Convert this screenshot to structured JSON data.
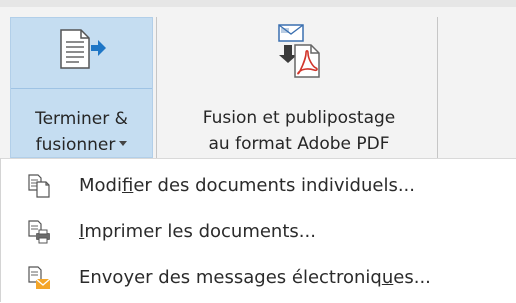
{
  "ribbon": {
    "finish_merge": {
      "line1": "Terminer &",
      "line2": "fusionner",
      "icon": "finish-merge-icon"
    },
    "pdf_merge": {
      "line1": "Fusion et publipostage",
      "line2": "au format Adobe PDF",
      "icon": "adobe-pdf-merge-icon"
    }
  },
  "menu": {
    "items": [
      {
        "pre": "Modi",
        "u": "f",
        "post": "ier des documents individuels...",
        "icon": "edit-documents-icon"
      },
      {
        "pre": "",
        "u": "I",
        "post": "mprimer les documents...",
        "icon": "print-documents-icon"
      },
      {
        "pre": "Envoyer des messages électroniq",
        "u": "u",
        "post": "es...",
        "icon": "send-email-icon"
      }
    ]
  },
  "colors": {
    "selected_bg": "#c5ddf1",
    "ribbon_bg": "#f3f3f3",
    "accent_blue": "#1e76c6",
    "pdf_red": "#d2352b",
    "mail_orange": "#f4a62a"
  }
}
